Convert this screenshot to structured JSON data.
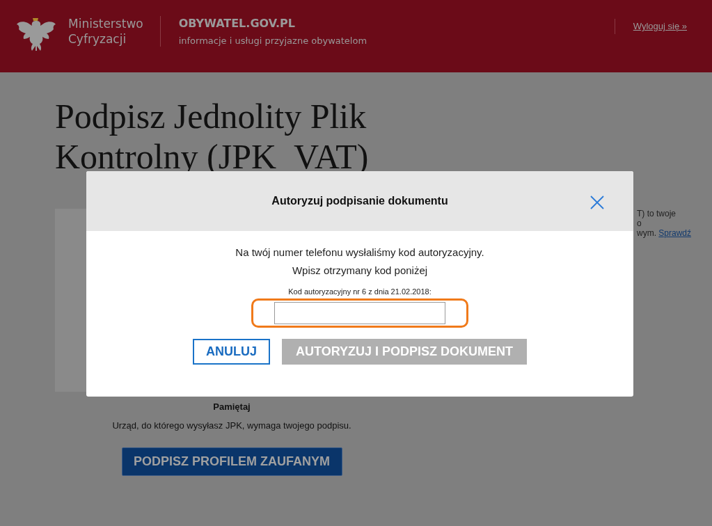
{
  "header": {
    "ministry": [
      "Ministerstwo",
      "Cyfryzacji"
    ],
    "site_title": "OBYWATEL.GOV.PL",
    "site_subtitle": "informacje i usługi przyjazne obywatelom",
    "logout": "Wyloguj się »"
  },
  "page": {
    "title": "Podpisz Jednolity Plik Kontrolny (JPK_VAT)",
    "side_fragments": [
      {
        "text": "T) to twoje"
      },
      {
        "text": "o"
      },
      {
        "text": "wym.",
        "link": "Sprawdź"
      }
    ],
    "remember_heading": "Pamiętaj",
    "remember_text": "Urząd, do którego wysyłasz JPK, wymaga twojego podpisu.",
    "sign_button": "PODPISZ PROFILEM ZAUFANYM"
  },
  "modal": {
    "title": "Autoryzuj podpisanie dokumentu",
    "lines": [
      "Na twój numer telefonu wysłaliśmy kod autoryzacyjny.",
      "Wpisz otrzymany kod poniżej"
    ],
    "code_label": "Kod autoryzacyjny nr 6 z dnia 21.02.2018:",
    "highlighted": true,
    "buttons": [
      {
        "label": "ANULUJ",
        "kind": "outline",
        "disabled": false
      },
      {
        "label": "AUTORYZUJ I PODPISZ DOKUMENT",
        "kind": "primary",
        "disabled": true
      }
    ]
  }
}
